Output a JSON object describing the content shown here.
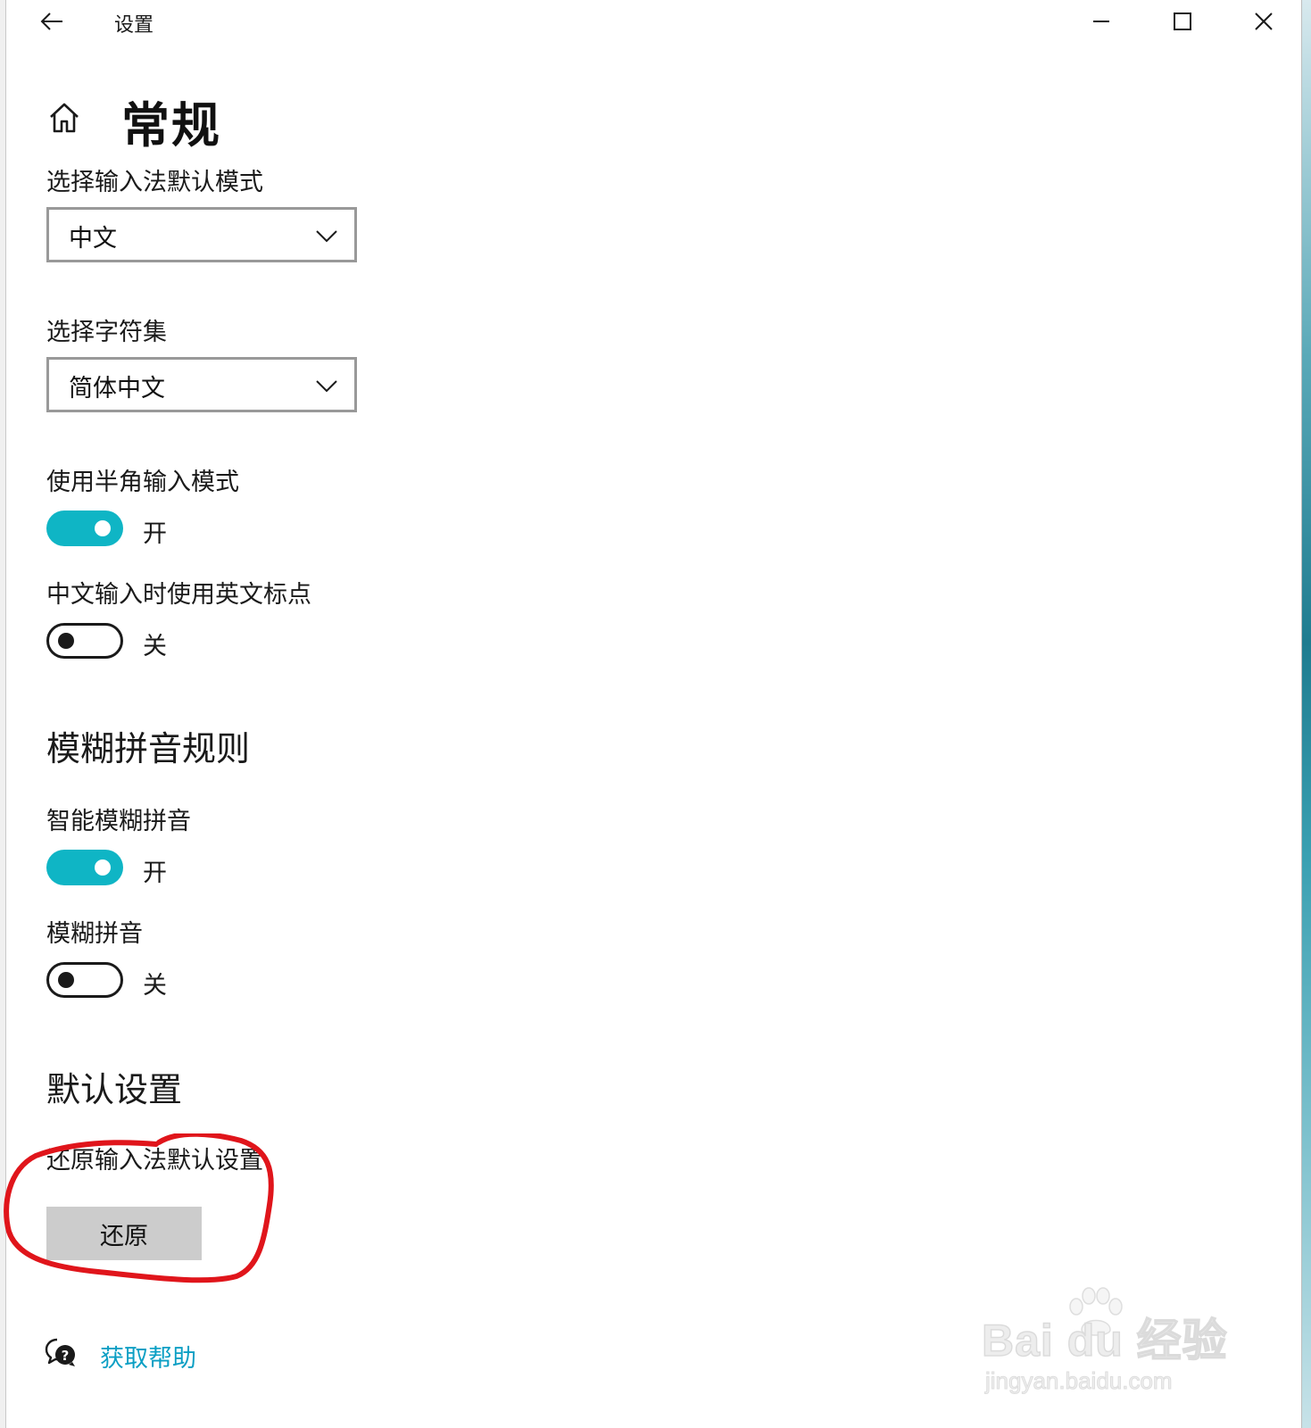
{
  "window": {
    "title": "设置"
  },
  "page": {
    "title": "常规"
  },
  "ime_mode": {
    "label": "选择输入法默认模式",
    "selected": "中文"
  },
  "charset": {
    "label": "选择字符集",
    "selected": "简体中文"
  },
  "half_width": {
    "label": "使用半角输入模式",
    "state_label": "开",
    "enabled": true
  },
  "english_punct": {
    "label": "中文输入时使用英文标点",
    "state_label": "关",
    "enabled": false
  },
  "fuzzy_section": {
    "heading": "模糊拼音规则"
  },
  "smart_fuzzy": {
    "label": "智能模糊拼音",
    "state_label": "开",
    "enabled": true
  },
  "fuzzy_pinyin": {
    "label": "模糊拼音",
    "state_label": "关",
    "enabled": false
  },
  "defaults_section": {
    "heading": "默认设置",
    "restore_label": "还原输入法默认设置",
    "restore_button": "还原"
  },
  "help": {
    "link_text": "获取帮助"
  },
  "watermark": {
    "brand": "Bai du 经验",
    "url": "jingyan.baidu.com"
  },
  "colors": {
    "toggle_on": "#0fb5c5",
    "link": "#0b9fc4",
    "annotation": "#e0151b",
    "button_bg": "#cccccc"
  }
}
